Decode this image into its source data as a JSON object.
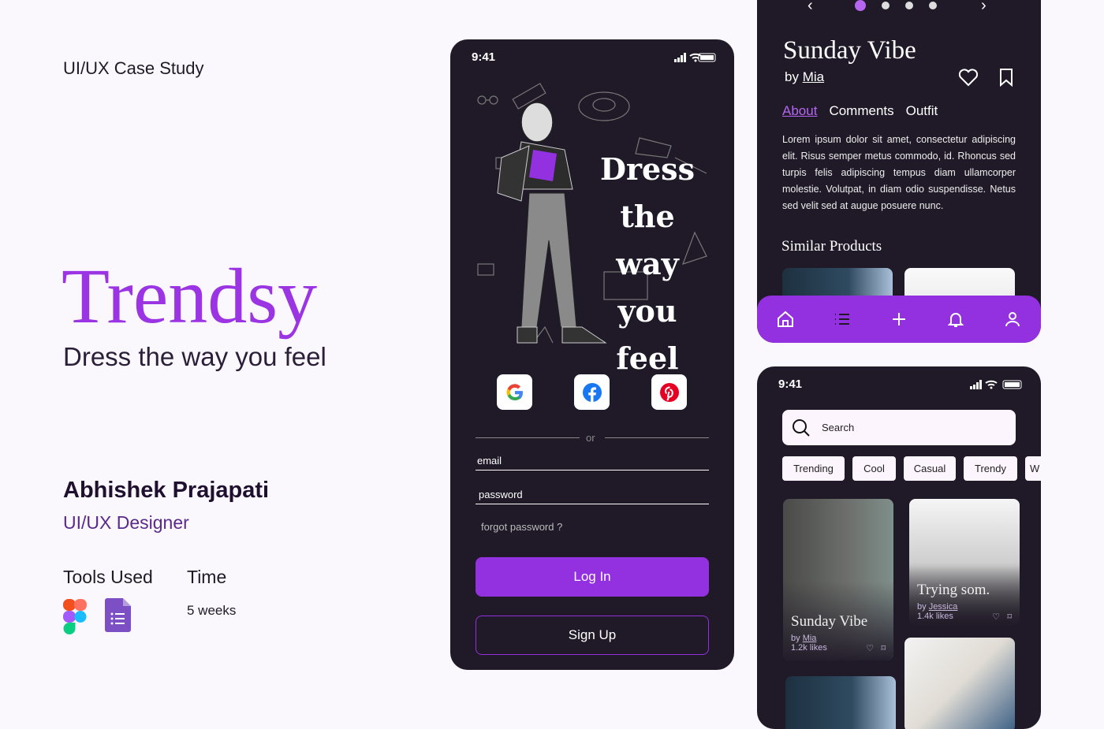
{
  "left": {
    "case_study": "UI/UX Case Study",
    "brand": "Trendsy",
    "tagline": "Dress the way you feel",
    "author": "Abhishek Prajapati",
    "role": "UI/UX Designer",
    "tools_heading": "Tools Used",
    "time_heading": "Time",
    "time_value": "5 weeks",
    "tools": [
      "figma-icon",
      "google-forms-icon"
    ]
  },
  "login": {
    "time": "9:41",
    "hero_lines": [
      "Dress",
      "the way",
      "you feel"
    ],
    "social": [
      "google-icon",
      "facebook-icon",
      "pinterest-icon"
    ],
    "or": "or",
    "email": "email",
    "password": "password",
    "forgot": "forgot password ?",
    "login": "Log In",
    "signup": "Sign Up"
  },
  "detail": {
    "title": "Sunday Vibe",
    "by": "by",
    "author": "Mia",
    "tabs": [
      "About",
      "Comments",
      "Outfit"
    ],
    "body": "Lorem ipsum dolor sit amet, consectetur adipiscing elit. Risus semper metus commodo, id. Rhoncus sed turpis felis adipiscing tempus diam ullamcorper molestie. Volutpat, in diam odio suspendisse. Netus sed velit sed at augue posuere nunc.",
    "similar": "Similar Products",
    "carousel_active": 1,
    "carousel_count": 4,
    "nav": [
      "home-icon",
      "list-icon",
      "plus-icon",
      "bell-icon",
      "user-icon"
    ]
  },
  "feed": {
    "time": "9:41",
    "search_placeholder": "Search",
    "chips": [
      "Trending",
      "Cool",
      "Casual",
      "Trendy",
      "W"
    ],
    "cards": [
      {
        "title": "Sunday Vibe",
        "by": "by",
        "author": "Mia",
        "likes": "1.2k likes"
      },
      {
        "title": "Trying som.",
        "by": "by",
        "author": "Jessica",
        "likes": "1.4k likes"
      }
    ]
  },
  "colors": {
    "accent": "#9330e0",
    "dark": "#201a28",
    "background": "#fbf8fd"
  }
}
